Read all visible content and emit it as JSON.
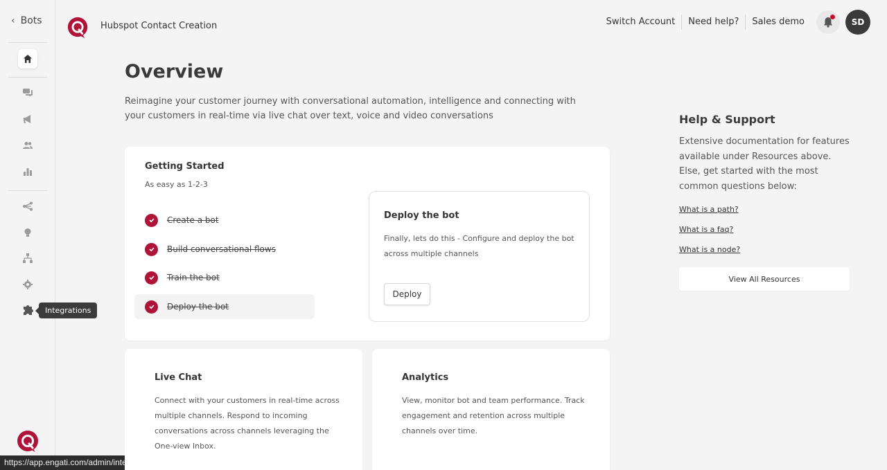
{
  "sidebar": {
    "back_label": "Bots",
    "tooltip": "Integrations",
    "icons": [
      "home-icon",
      "chat-icon",
      "megaphone-icon",
      "users-icon",
      "bar-chart-icon",
      "flow-icon",
      "bulb-icon",
      "hierarchy-icon",
      "gear-icon",
      "puzzle-icon"
    ]
  },
  "header": {
    "app_title": "Hubspot Contact Creation",
    "switch_account": "Switch Account",
    "need_help": "Need help?",
    "account_name": "Sales demo",
    "avatar_initials": "SD"
  },
  "main": {
    "title": "Overview",
    "description": "Reimagine your customer journey with conversational automation, intelligence and connecting with your customers in real-time via live chat over text, voice and video conversations",
    "getting_started": {
      "title": "Getting Started",
      "subtitle": "As easy as 1-2-3",
      "steps": [
        {
          "label": "Create a bot"
        },
        {
          "label": "Build conversational flows"
        },
        {
          "label": "Train the bot"
        },
        {
          "label": "Deploy the bot"
        }
      ],
      "deploy": {
        "title": "Deploy the bot",
        "description": "Finally, lets do this - Configure and deploy the bot across multiple channels",
        "button": "Deploy"
      }
    },
    "live_chat": {
      "title": "Live Chat",
      "description": "Connect with your customers in real-time across multiple channels. Respond to incoming conversations across channels leveraging the One-view Inbox."
    },
    "analytics": {
      "title": "Analytics",
      "description": "View, monitor bot and team performance. Track engagement and retention across multiple channels over time."
    }
  },
  "help": {
    "title": "Help & Support",
    "description": "Extensive documentation for features available under Resources above. Else, get started with the most common questions below:",
    "links": [
      "What is a path?",
      "What is a faq?",
      "What is a node?"
    ],
    "view_all": "View All Resources"
  },
  "statusbar": {
    "url": "https://app.engati.com/admin/integrations"
  },
  "colors": {
    "brand": "#b0133a",
    "notification": "#c8102e"
  }
}
